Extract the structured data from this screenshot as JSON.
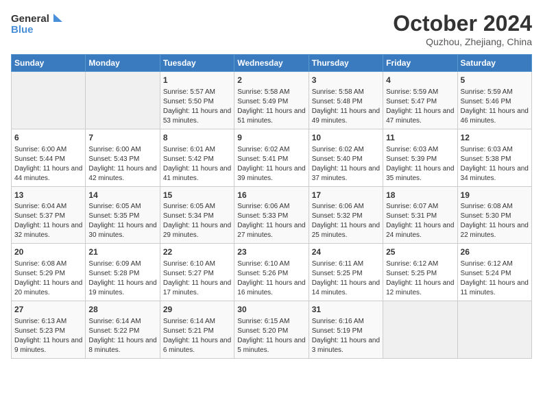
{
  "logo": {
    "line1": "General",
    "line2": "Blue"
  },
  "title": "October 2024",
  "subtitle": "Quzhou, Zhejiang, China",
  "days_header": [
    "Sunday",
    "Monday",
    "Tuesday",
    "Wednesday",
    "Thursday",
    "Friday",
    "Saturday"
  ],
  "weeks": [
    [
      {
        "day": "",
        "info": ""
      },
      {
        "day": "",
        "info": ""
      },
      {
        "day": "1",
        "info": "Sunrise: 5:57 AM\nSunset: 5:50 PM\nDaylight: 11 hours and 53 minutes."
      },
      {
        "day": "2",
        "info": "Sunrise: 5:58 AM\nSunset: 5:49 PM\nDaylight: 11 hours and 51 minutes."
      },
      {
        "day": "3",
        "info": "Sunrise: 5:58 AM\nSunset: 5:48 PM\nDaylight: 11 hours and 49 minutes."
      },
      {
        "day": "4",
        "info": "Sunrise: 5:59 AM\nSunset: 5:47 PM\nDaylight: 11 hours and 47 minutes."
      },
      {
        "day": "5",
        "info": "Sunrise: 5:59 AM\nSunset: 5:46 PM\nDaylight: 11 hours and 46 minutes."
      }
    ],
    [
      {
        "day": "6",
        "info": "Sunrise: 6:00 AM\nSunset: 5:44 PM\nDaylight: 11 hours and 44 minutes."
      },
      {
        "day": "7",
        "info": "Sunrise: 6:00 AM\nSunset: 5:43 PM\nDaylight: 11 hours and 42 minutes."
      },
      {
        "day": "8",
        "info": "Sunrise: 6:01 AM\nSunset: 5:42 PM\nDaylight: 11 hours and 41 minutes."
      },
      {
        "day": "9",
        "info": "Sunrise: 6:02 AM\nSunset: 5:41 PM\nDaylight: 11 hours and 39 minutes."
      },
      {
        "day": "10",
        "info": "Sunrise: 6:02 AM\nSunset: 5:40 PM\nDaylight: 11 hours and 37 minutes."
      },
      {
        "day": "11",
        "info": "Sunrise: 6:03 AM\nSunset: 5:39 PM\nDaylight: 11 hours and 35 minutes."
      },
      {
        "day": "12",
        "info": "Sunrise: 6:03 AM\nSunset: 5:38 PM\nDaylight: 11 hours and 34 minutes."
      }
    ],
    [
      {
        "day": "13",
        "info": "Sunrise: 6:04 AM\nSunset: 5:37 PM\nDaylight: 11 hours and 32 minutes."
      },
      {
        "day": "14",
        "info": "Sunrise: 6:05 AM\nSunset: 5:35 PM\nDaylight: 11 hours and 30 minutes."
      },
      {
        "day": "15",
        "info": "Sunrise: 6:05 AM\nSunset: 5:34 PM\nDaylight: 11 hours and 29 minutes."
      },
      {
        "day": "16",
        "info": "Sunrise: 6:06 AM\nSunset: 5:33 PM\nDaylight: 11 hours and 27 minutes."
      },
      {
        "day": "17",
        "info": "Sunrise: 6:06 AM\nSunset: 5:32 PM\nDaylight: 11 hours and 25 minutes."
      },
      {
        "day": "18",
        "info": "Sunrise: 6:07 AM\nSunset: 5:31 PM\nDaylight: 11 hours and 24 minutes."
      },
      {
        "day": "19",
        "info": "Sunrise: 6:08 AM\nSunset: 5:30 PM\nDaylight: 11 hours and 22 minutes."
      }
    ],
    [
      {
        "day": "20",
        "info": "Sunrise: 6:08 AM\nSunset: 5:29 PM\nDaylight: 11 hours and 20 minutes."
      },
      {
        "day": "21",
        "info": "Sunrise: 6:09 AM\nSunset: 5:28 PM\nDaylight: 11 hours and 19 minutes."
      },
      {
        "day": "22",
        "info": "Sunrise: 6:10 AM\nSunset: 5:27 PM\nDaylight: 11 hours and 17 minutes."
      },
      {
        "day": "23",
        "info": "Sunrise: 6:10 AM\nSunset: 5:26 PM\nDaylight: 11 hours and 16 minutes."
      },
      {
        "day": "24",
        "info": "Sunrise: 6:11 AM\nSunset: 5:25 PM\nDaylight: 11 hours and 14 minutes."
      },
      {
        "day": "25",
        "info": "Sunrise: 6:12 AM\nSunset: 5:25 PM\nDaylight: 11 hours and 12 minutes."
      },
      {
        "day": "26",
        "info": "Sunrise: 6:12 AM\nSunset: 5:24 PM\nDaylight: 11 hours and 11 minutes."
      }
    ],
    [
      {
        "day": "27",
        "info": "Sunrise: 6:13 AM\nSunset: 5:23 PM\nDaylight: 11 hours and 9 minutes."
      },
      {
        "day": "28",
        "info": "Sunrise: 6:14 AM\nSunset: 5:22 PM\nDaylight: 11 hours and 8 minutes."
      },
      {
        "day": "29",
        "info": "Sunrise: 6:14 AM\nSunset: 5:21 PM\nDaylight: 11 hours and 6 minutes."
      },
      {
        "day": "30",
        "info": "Sunrise: 6:15 AM\nSunset: 5:20 PM\nDaylight: 11 hours and 5 minutes."
      },
      {
        "day": "31",
        "info": "Sunrise: 6:16 AM\nSunset: 5:19 PM\nDaylight: 11 hours and 3 minutes."
      },
      {
        "day": "",
        "info": ""
      },
      {
        "day": "",
        "info": ""
      }
    ]
  ]
}
